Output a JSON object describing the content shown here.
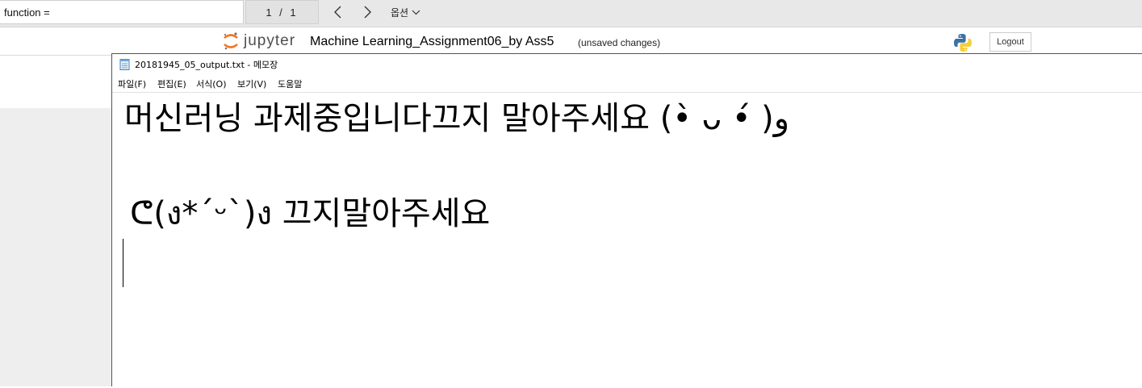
{
  "find_bar": {
    "query": "function =",
    "match_count": "1 / 1",
    "options_label": "옵션"
  },
  "jupyter": {
    "logo_text": "jupyter",
    "notebook_title": "Machine Learning_Assignment06_by Ass5",
    "save_status": "(unsaved changes)",
    "logout_label": "Logout",
    "kernel_icon": "python-icon",
    "logo_color": "#f37726"
  },
  "notepad": {
    "window_title": "20181945_05_output.txt - 메모장",
    "menu": [
      {
        "label": "파일(F)"
      },
      {
        "label": "편집(E)"
      },
      {
        "label": "서식(O)"
      },
      {
        "label": "보기(V)"
      },
      {
        "label": "도움말"
      }
    ],
    "lines": [
      "머신러닝 과제중입니다끄지 말아주세요 (•̀ ᴗ •́ )و",
      "ᕦ(ง*ˊᵕˋ)ง 끄지말아주세요"
    ]
  }
}
